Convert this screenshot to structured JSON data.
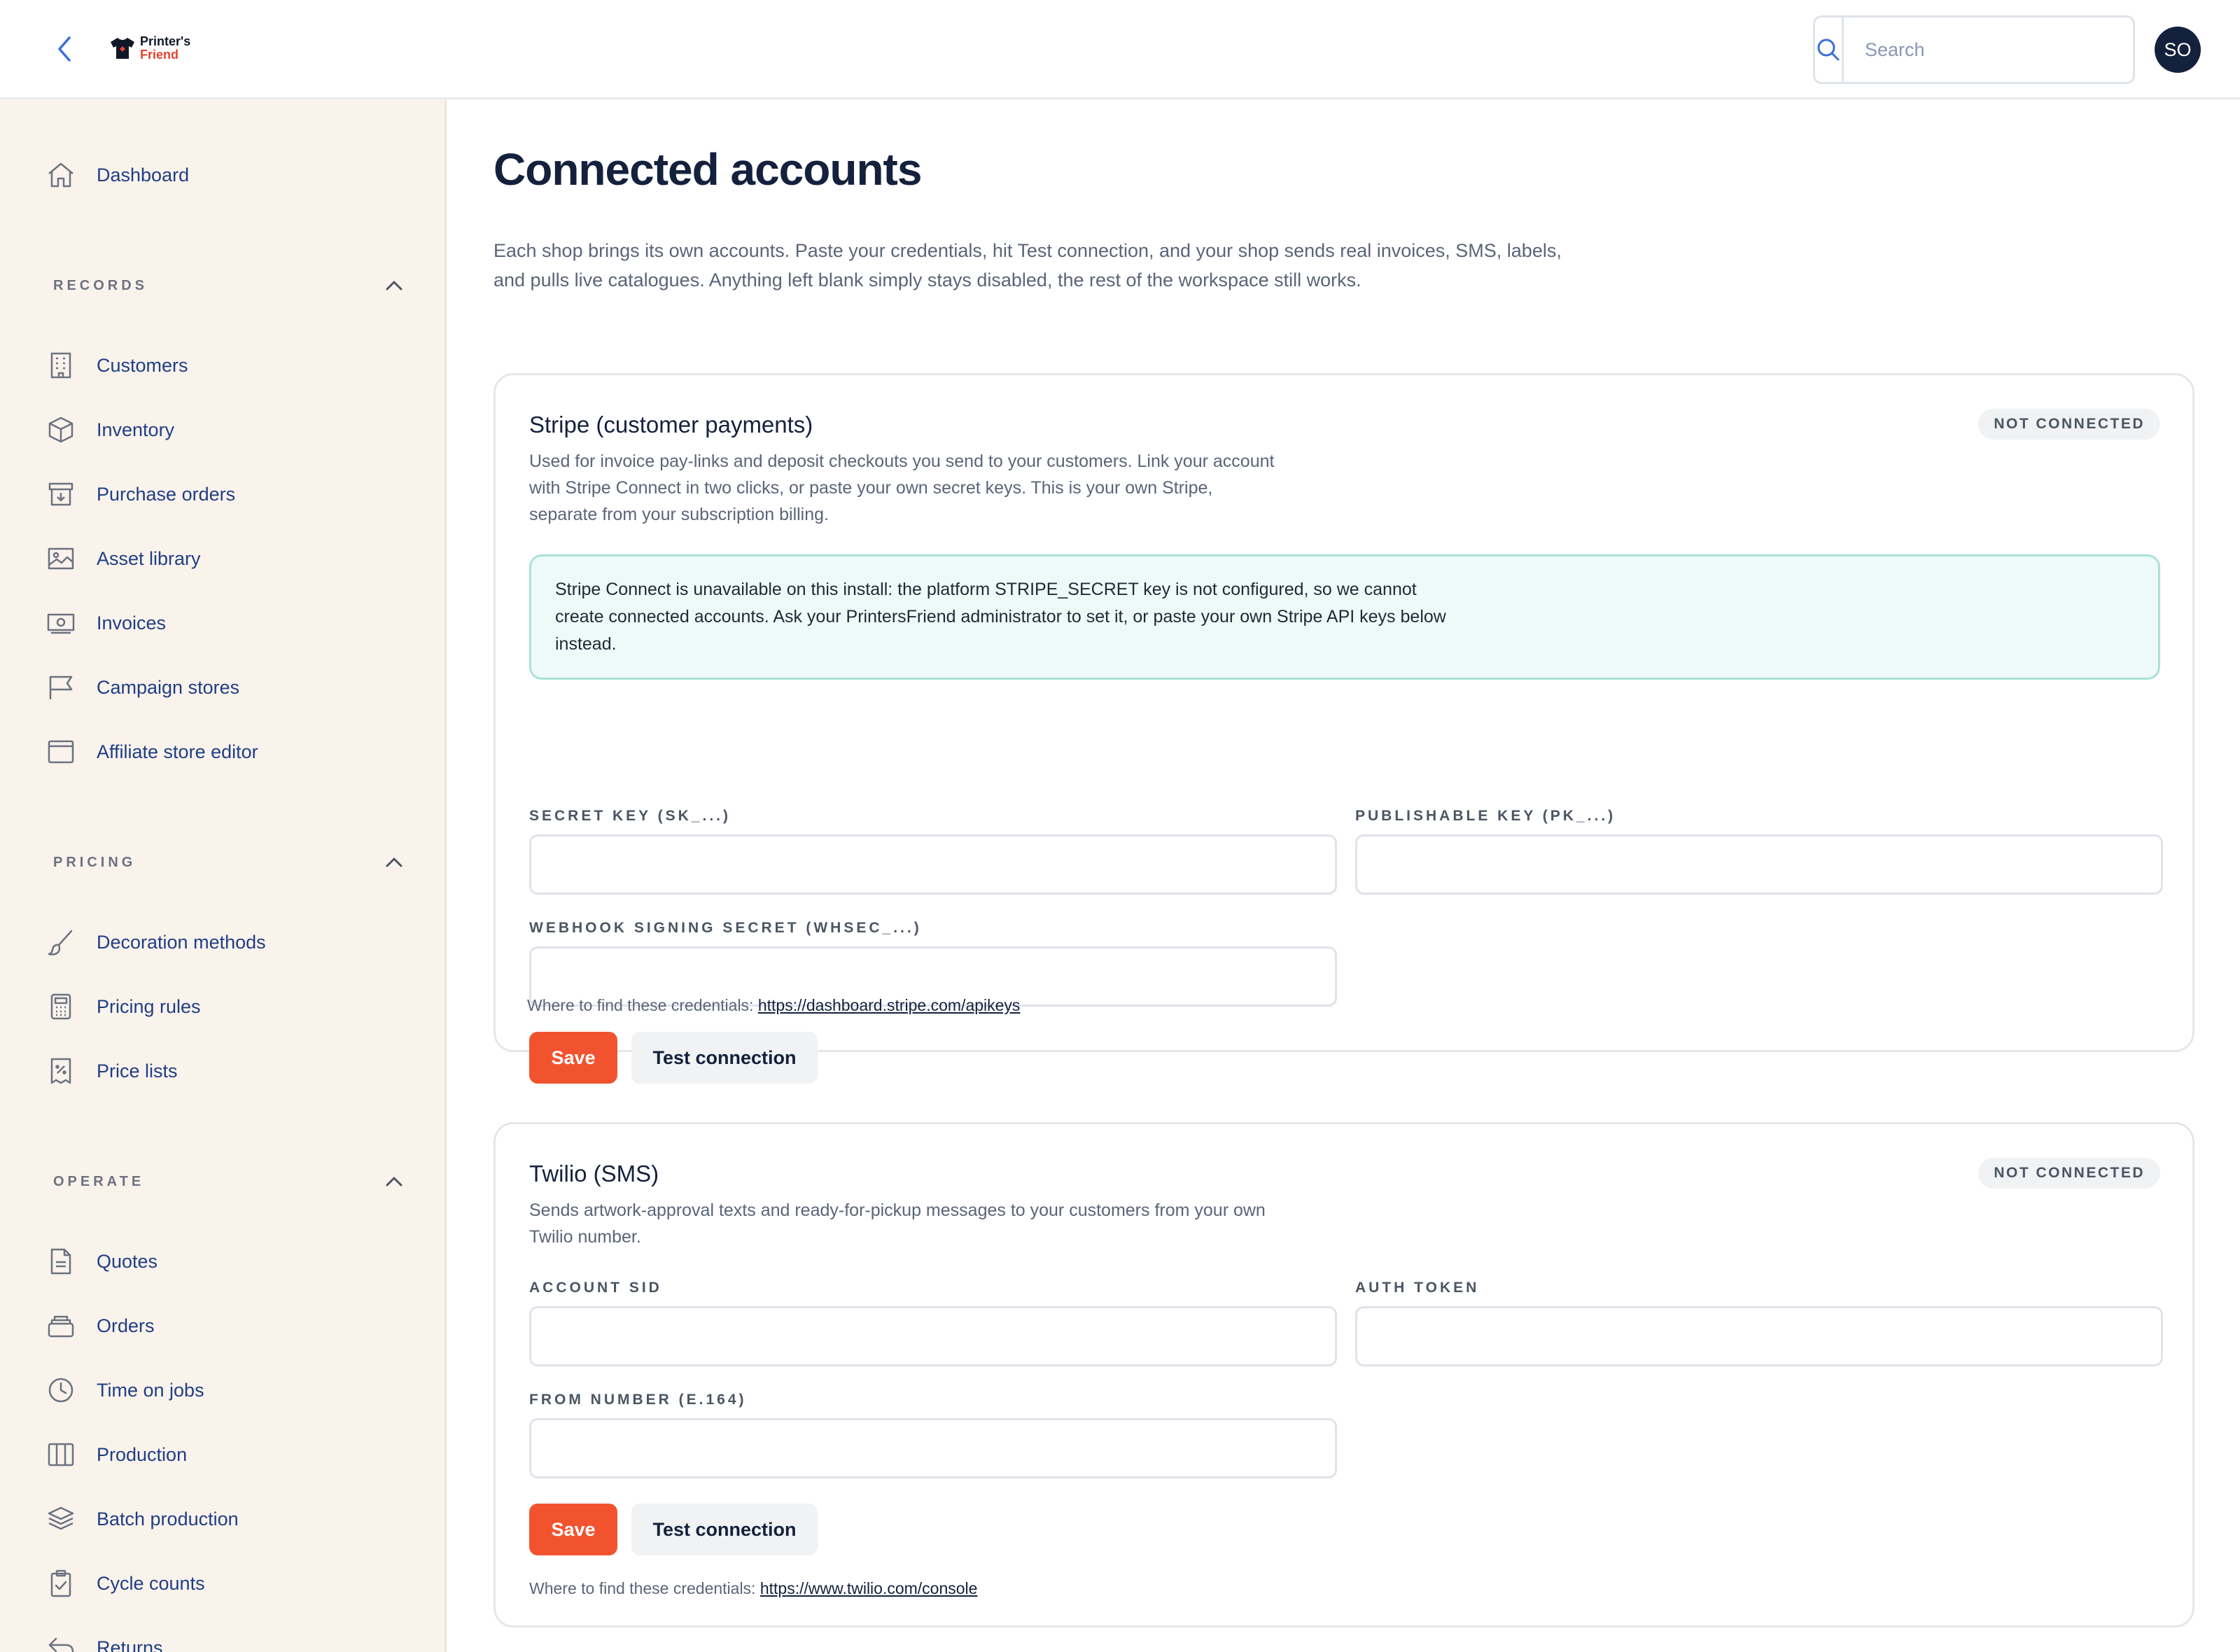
{
  "header": {
    "logo_line1": "Printer's",
    "logo_line2": "Friend",
    "search_placeholder": "Search",
    "avatar_initials": "SO"
  },
  "sidebar": {
    "dashboard": "Dashboard",
    "sections": [
      {
        "title": "RECORDS",
        "items": [
          "Customers",
          "Inventory",
          "Purchase orders",
          "Asset library",
          "Invoices",
          "Campaign stores",
          "Affiliate store editor"
        ]
      },
      {
        "title": "PRICING",
        "items": [
          "Decoration methods",
          "Pricing rules",
          "Price lists"
        ]
      },
      {
        "title": "OPERATE",
        "items": [
          "Quotes",
          "Orders",
          "Time on jobs",
          "Production",
          "Batch production",
          "Cycle counts",
          "Returns"
        ]
      }
    ]
  },
  "main": {
    "title": "Connected accounts",
    "description": "Each shop brings its own accounts. Paste your credentials, hit Test connection, and your shop sends real invoices, SMS, labels, and pulls live catalogues. Anything left blank simply stays disabled, the rest of the workspace still works.",
    "cards": [
      {
        "title": "Stripe (customer payments)",
        "status": "NOT CONNECTED",
        "description": "Used for invoice pay-links and deposit checkouts you send to your customers. Link your account with Stripe Connect in two clicks, or paste your own secret keys. This is your own Stripe, separate from your subscription billing.",
        "notice": "Stripe Connect is unavailable on this install: the platform STRIPE_SECRET key is not configured, so we cannot create connected accounts. Ask your PrintersFriend administrator to set it, or paste your own Stripe API keys below instead.",
        "fields": [
          {
            "label": "SECRET KEY (SK_...)",
            "value": ""
          },
          {
            "label": "PUBLISHABLE KEY (PK_...)",
            "value": ""
          },
          {
            "label": "WEBHOOK SIGNING SECRET (WHSEC_...)",
            "value": ""
          }
        ],
        "save_label": "Save",
        "test_label": "Test connection",
        "find_prefix": "Where to find these credentials:",
        "find_link": "https://dashboard.stripe.com/apikeys"
      },
      {
        "title": "Twilio (SMS)",
        "status": "NOT CONNECTED",
        "description": "Sends artwork-approval texts and ready-for-pickup messages to your customers from your own Twilio number.",
        "fields": [
          {
            "label": "ACCOUNT SID",
            "value": ""
          },
          {
            "label": "AUTH TOKEN",
            "value": ""
          },
          {
            "label": "FROM NUMBER (E.164)",
            "value": ""
          }
        ],
        "save_label": "Save",
        "test_label": "Test connection",
        "find_prefix": "Where to find these credentials:",
        "find_link": "https://www.twilio.com/console"
      }
    ]
  },
  "colors": {
    "accent": "#f2532f",
    "nav_text": "#1f3e85",
    "sidebar_bg": "#faf3ec",
    "notice_bg": "#eefaf7",
    "notice_border": "#a8e2d6",
    "avatar_bg": "#14213d"
  },
  "icons": {
    "back": "chevron-left-icon",
    "search": "search-icon",
    "dashboard": "home-icon",
    "customers": "building-icon",
    "inventory": "box-icon",
    "purchase_orders": "archive-icon",
    "asset_library": "image-icon",
    "invoices": "money-icon",
    "campaign_stores": "flag-icon",
    "affiliate_store_editor": "browser-icon",
    "decoration_methods": "brush-icon",
    "pricing_rules": "calculator-icon",
    "price_lists": "receipt-icon",
    "quotes": "document-icon",
    "orders": "stack-icon",
    "time_on_jobs": "clock-icon",
    "production": "columns-icon",
    "batch_production": "layers-icon",
    "cycle_counts": "clipboard-icon",
    "returns": "return-arrow-icon"
  }
}
